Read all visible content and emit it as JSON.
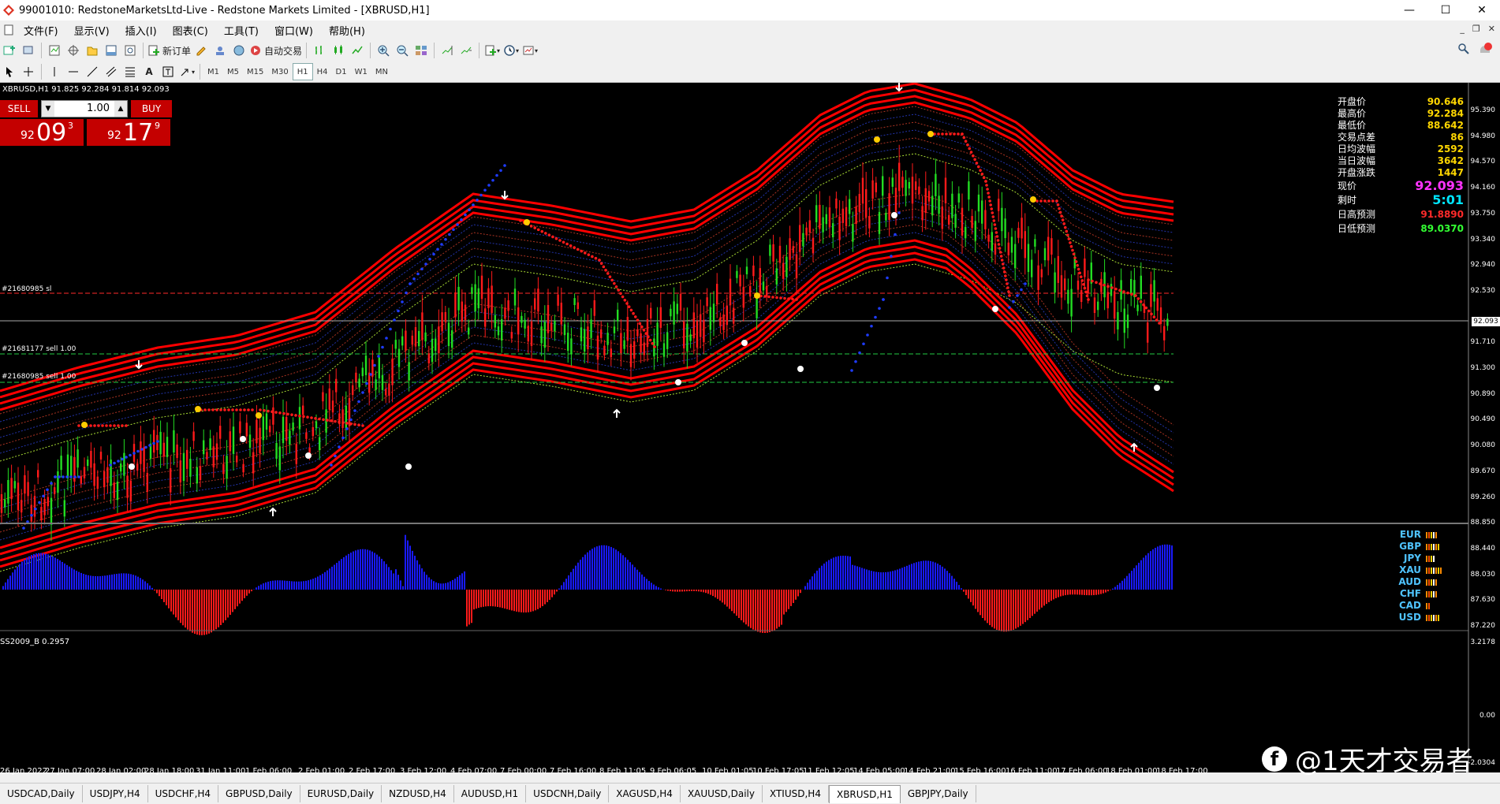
{
  "window": {
    "title": "99001010: RedstoneMarketsLtd-Live - Redstone Markets Limited - [XBRUSD,H1]",
    "controls": [
      "—",
      "☐",
      "✕"
    ]
  },
  "menu": {
    "items": [
      "文件(F)",
      "显示(V)",
      "插入(I)",
      "图表(C)",
      "工具(T)",
      "窗口(W)",
      "帮助(H)"
    ]
  },
  "toolbar": {
    "new_order": "新订单",
    "auto_trade": "自动交易",
    "timeframes": [
      "M1",
      "M5",
      "M15",
      "M30",
      "H1",
      "H4",
      "D1",
      "W1",
      "MN"
    ],
    "active_timeframe": "H1"
  },
  "chart": {
    "symbol_line": "XBRUSD,H1  91.825 92.284 91.814 92.093",
    "sell_label": "SELL",
    "buy_label": "BUY",
    "lot": "1.00",
    "sell_price": {
      "small": "92",
      "big": "09",
      "sup": "3"
    },
    "buy_price": {
      "small": "92",
      "big": "17",
      "sup": "9"
    },
    "orders": [
      {
        "label": "#21680985 sl",
        "color": "#ff2a2a"
      },
      {
        "label": "#21681177 sell 1.00",
        "color": "#22cc44"
      },
      {
        "label": "#21680985 sell 1.00",
        "color": "#22cc44"
      }
    ],
    "indicator_label": "SS2009_B 0.2957",
    "current_price": "92.093",
    "price_axis": [
      "95.390",
      "94.980",
      "94.570",
      "94.160",
      "93.750",
      "93.340",
      "92.940",
      "92.530",
      "91.710",
      "91.300",
      "90.890",
      "90.490",
      "90.080",
      "89.670",
      "89.260",
      "88.850",
      "88.440",
      "88.030",
      "87.630",
      "87.220"
    ],
    "indicator_axis": [
      "3.2178",
      "0.00",
      "-2.0304"
    ],
    "dates": [
      "26 Jan 2022",
      "27 Jan 07:00",
      "28 Jan 02:00",
      "28 Jan 18:00",
      "31 Jan 11:00",
      "1 Feb 06:00",
      "2 Feb 01:00",
      "2 Feb 17:00",
      "3 Feb 12:00",
      "4 Feb 07:00",
      "7 Feb 00:00",
      "7 Feb 16:00",
      "8 Feb 11:05",
      "9 Feb 06:05",
      "10 Feb 01:05",
      "10 Feb 17:05",
      "11 Feb 12:05",
      "14 Feb 05:00",
      "14 Feb 21:00",
      "15 Feb 16:00",
      "16 Feb 11:00",
      "17 Feb 06:00",
      "18 Feb 01:00",
      "18 Feb 17:00"
    ]
  },
  "info_panel": [
    {
      "k": "开盘价",
      "v": "90.646",
      "color": "#ffd700"
    },
    {
      "k": "最高价",
      "v": "92.284",
      "color": "#ffd700"
    },
    {
      "k": "最低价",
      "v": "88.642",
      "color": "#ffd700"
    },
    {
      "k": "交易点差",
      "v": "86",
      "color": "#ffd700"
    },
    {
      "k": "日均波幅",
      "v": "2592",
      "color": "#ffd700"
    },
    {
      "k": "当日波幅",
      "v": "3642",
      "color": "#ffd700"
    },
    {
      "k": "开盘涨跌",
      "v": "1447",
      "color": "#ffd700"
    },
    {
      "k": "现价",
      "v": "92.093",
      "color": "#ff33ff"
    },
    {
      "k": "剩时",
      "v": "5:01",
      "color": "#00e5ff"
    },
    {
      "k": "日高预测",
      "v": "91.8890",
      "color": "#ff2a2a"
    },
    {
      "k": "日低预测",
      "v": "89.0370",
      "color": "#33ff33"
    }
  ],
  "currencies": [
    "EUR",
    "GBP",
    "JPY",
    "XAU",
    "AUD",
    "CHF",
    "CAD",
    "USD"
  ],
  "tabs": {
    "items": [
      "USDCAD,Daily",
      "USDJPY,H4",
      "USDCHF,H4",
      "GBPUSD,Daily",
      "EURUSD,Daily",
      "NZDUSD,H4",
      "AUDUSD,H1",
      "USDCNH,Daily",
      "XAGUSD,H4",
      "XAUUSD,Daily",
      "XTIUSD,H4",
      "XBRUSD,H1",
      "GBPJPY,Daily"
    ],
    "active": "XBRUSD,H1"
  },
  "watermark": "@1天才交易者",
  "colors": {
    "bull": "#22dd22",
    "bear": "#ff1a1a",
    "band": "#ff0000",
    "trend_up": "#1f3cff",
    "trend_down": "#ff1a1a",
    "hist_pos": "#1a1aff",
    "hist_neg": "#ff1a1a"
  }
}
